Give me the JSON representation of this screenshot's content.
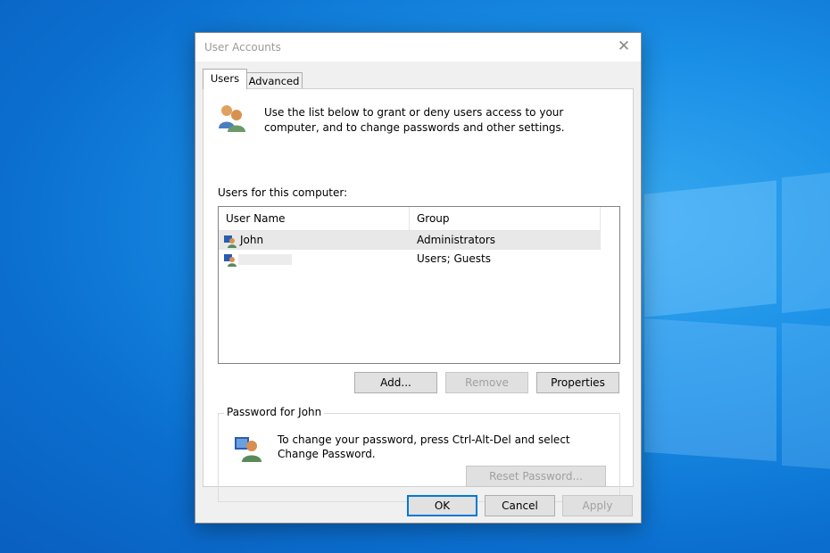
{
  "window": {
    "title": "User Accounts",
    "close_symbol": "✕"
  },
  "tabs": [
    {
      "label": "Users",
      "selected": true
    },
    {
      "label": "Advanced",
      "selected": false
    }
  ],
  "intro": {
    "text": "Use the list below to grant or deny users access to your computer, and to change passwords and other settings."
  },
  "users_section": {
    "label": "Users for this computer:"
  },
  "table": {
    "columns": [
      "User Name",
      "Group"
    ],
    "rows": [
      {
        "name": "John",
        "group": "Administrators",
        "selected": true
      },
      {
        "name": "",
        "group": "Users; Guests",
        "selected": false
      }
    ]
  },
  "user_buttons": {
    "add": "Add...",
    "remove": "Remove",
    "properties": "Properties"
  },
  "password_group": {
    "title": "Password for John",
    "text": "To change your password, press Ctrl-Alt-Del and select Change Password.",
    "reset_button": "Reset Password..."
  },
  "footer_buttons": {
    "ok": "OK",
    "cancel": "Cancel",
    "apply": "Apply"
  },
  "colors": {
    "accent": "#0078d7",
    "desktop": "#0b6fd0"
  }
}
